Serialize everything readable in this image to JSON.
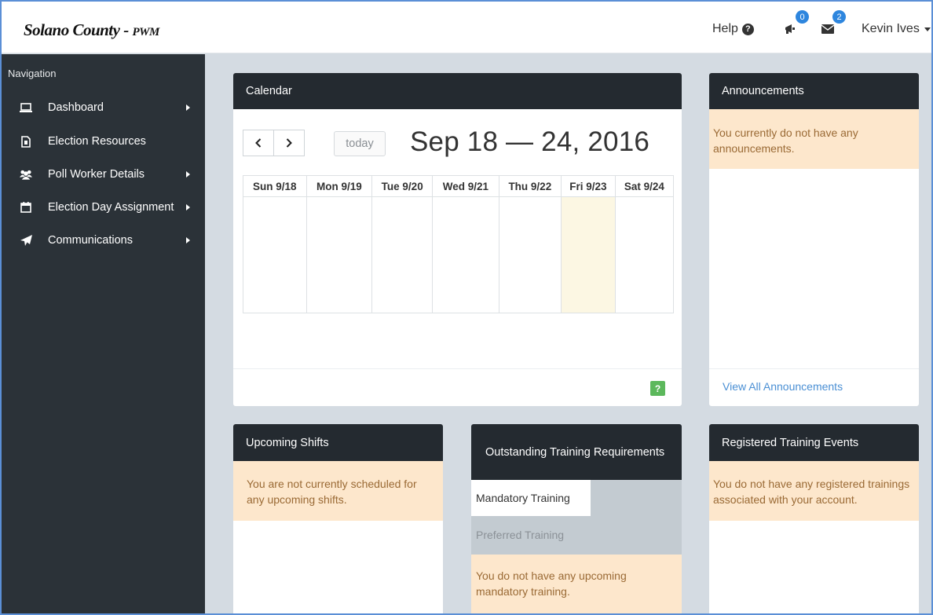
{
  "header": {
    "brand_main": "Solano County",
    "brand_sep": " - ",
    "brand_sub": "PWM",
    "help_label": "Help",
    "help_icon": "question-circle-icon",
    "announcements_badge": "0",
    "messages_badge": "2",
    "user_name": "Kevin Ives",
    "accent_color": "#2e86de"
  },
  "sidebar": {
    "title": "Navigation",
    "items": [
      {
        "label": "Dashboard",
        "icon": "laptop-icon",
        "has_submenu": true
      },
      {
        "label": "Election Resources",
        "icon": "file-icon",
        "has_submenu": false
      },
      {
        "label": "Poll Worker Details",
        "icon": "users-icon",
        "has_submenu": true
      },
      {
        "label": "Election Day Assignment",
        "icon": "calendar-icon",
        "has_submenu": true
      },
      {
        "label": "Communications",
        "icon": "paper-plane-icon",
        "has_submenu": true
      }
    ]
  },
  "calendar": {
    "title": "Calendar",
    "prev_icon": "chevron-left-icon",
    "next_icon": "chevron-right-icon",
    "today_label": "today",
    "range_title": "Sep 18 — 24, 2016",
    "days": [
      "Sun 9/18",
      "Mon 9/19",
      "Tue 9/20",
      "Wed 9/21",
      "Thu 9/22",
      "Fri 9/23",
      "Sat 9/24"
    ],
    "highlighted_day": "Fri 9/23",
    "help_button": "?"
  },
  "announcements": {
    "title": "Announcements",
    "message": "You currently do not have any announcements.",
    "view_all": "View All Announcements"
  },
  "upcoming_shifts": {
    "title": "Upcoming Shifts",
    "message": "You are not currently scheduled for any upcoming shifts."
  },
  "training_requirements": {
    "title": "Outstanding Training Requirements",
    "tabs": [
      "Mandatory Training",
      "Preferred Training"
    ],
    "active_tab": "Mandatory Training",
    "message": "You do not have any upcoming mandatory training."
  },
  "registered_training": {
    "title": "Registered Training Events",
    "message": "You do not have any registered trainings associated with your account."
  }
}
